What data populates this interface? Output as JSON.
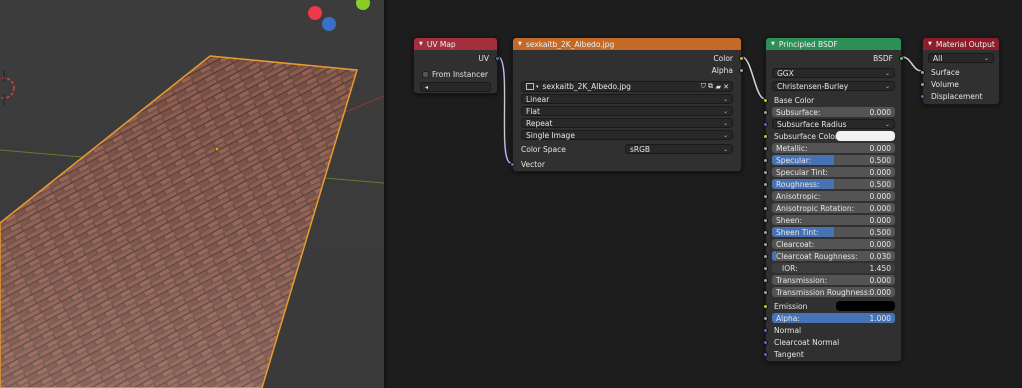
{
  "colors": {
    "header_red": "#a1303c",
    "header_orange": "#c46a28",
    "header_green": "#2b8f56",
    "header_material": "#8c1e2a",
    "slider_fill": "#4772b3",
    "selection": "#e89a2e"
  },
  "uv_map": {
    "title": "UV Map",
    "output_uv": "UV",
    "from_instancer": "From Instancer",
    "uv_field": ""
  },
  "image_texture": {
    "title": "sexkaitb_2K_Albedo.jpg",
    "output_color": "Color",
    "output_alpha": "Alpha",
    "image_name": "sexkaitb_2K_Albedo.jpg",
    "interpolation": "Linear",
    "projection": "Flat",
    "extension": "Repeat",
    "source": "Single Image",
    "color_space_label": "Color Space",
    "color_space_value": "sRGB",
    "input_vector": "Vector"
  },
  "bsdf": {
    "title": "Principled BSDF",
    "output": "BSDF",
    "distribution": "GGX",
    "subsurface_method": "Christensen-Burley",
    "base_color": "Base Color",
    "subsurface": {
      "label": "Subsurface:",
      "value": "0.000"
    },
    "subsurface_radius": "Subsurface Radius",
    "subsurface_color": "Subsurface Color",
    "metallic": {
      "label": "Metallic:",
      "value": "0.000"
    },
    "specular": {
      "label": "Specular:",
      "value": "0.500",
      "fill": 0.5
    },
    "specular_tint": {
      "label": "Specular Tint:",
      "value": "0.000"
    },
    "roughness": {
      "label": "Roughness:",
      "value": "0.500",
      "fill": 0.5
    },
    "anisotropic": {
      "label": "Anisotropic:",
      "value": "0.000"
    },
    "anisotropic_rotation": {
      "label": "Anisotropic Rotation:",
      "value": "0.000"
    },
    "sheen": {
      "label": "Sheen:",
      "value": "0.000"
    },
    "sheen_tint": {
      "label": "Sheen Tint:",
      "value": "0.500",
      "fill": 0.5
    },
    "clearcoat": {
      "label": "Clearcoat:",
      "value": "0.000"
    },
    "clearcoat_roughness": {
      "label": "Clearcoat Roughness:",
      "value": "0.030",
      "fill": 0.03
    },
    "ior": {
      "label": "IOR:",
      "value": "1.450"
    },
    "transmission": {
      "label": "Transmission:",
      "value": "0.000"
    },
    "transmission_roughness": {
      "label": "Transmission Roughness:",
      "value": "0.000"
    },
    "emission": "Emission",
    "alpha": {
      "label": "Alpha:",
      "value": "1.000",
      "fill": 1.0
    },
    "normal": "Normal",
    "clearcoat_normal": "Clearcoat Normal",
    "tangent": "Tangent"
  },
  "material_output": {
    "title": "Material Output",
    "target": "All",
    "surface": "Surface",
    "volume": "Volume",
    "displacement": "Displacement"
  }
}
